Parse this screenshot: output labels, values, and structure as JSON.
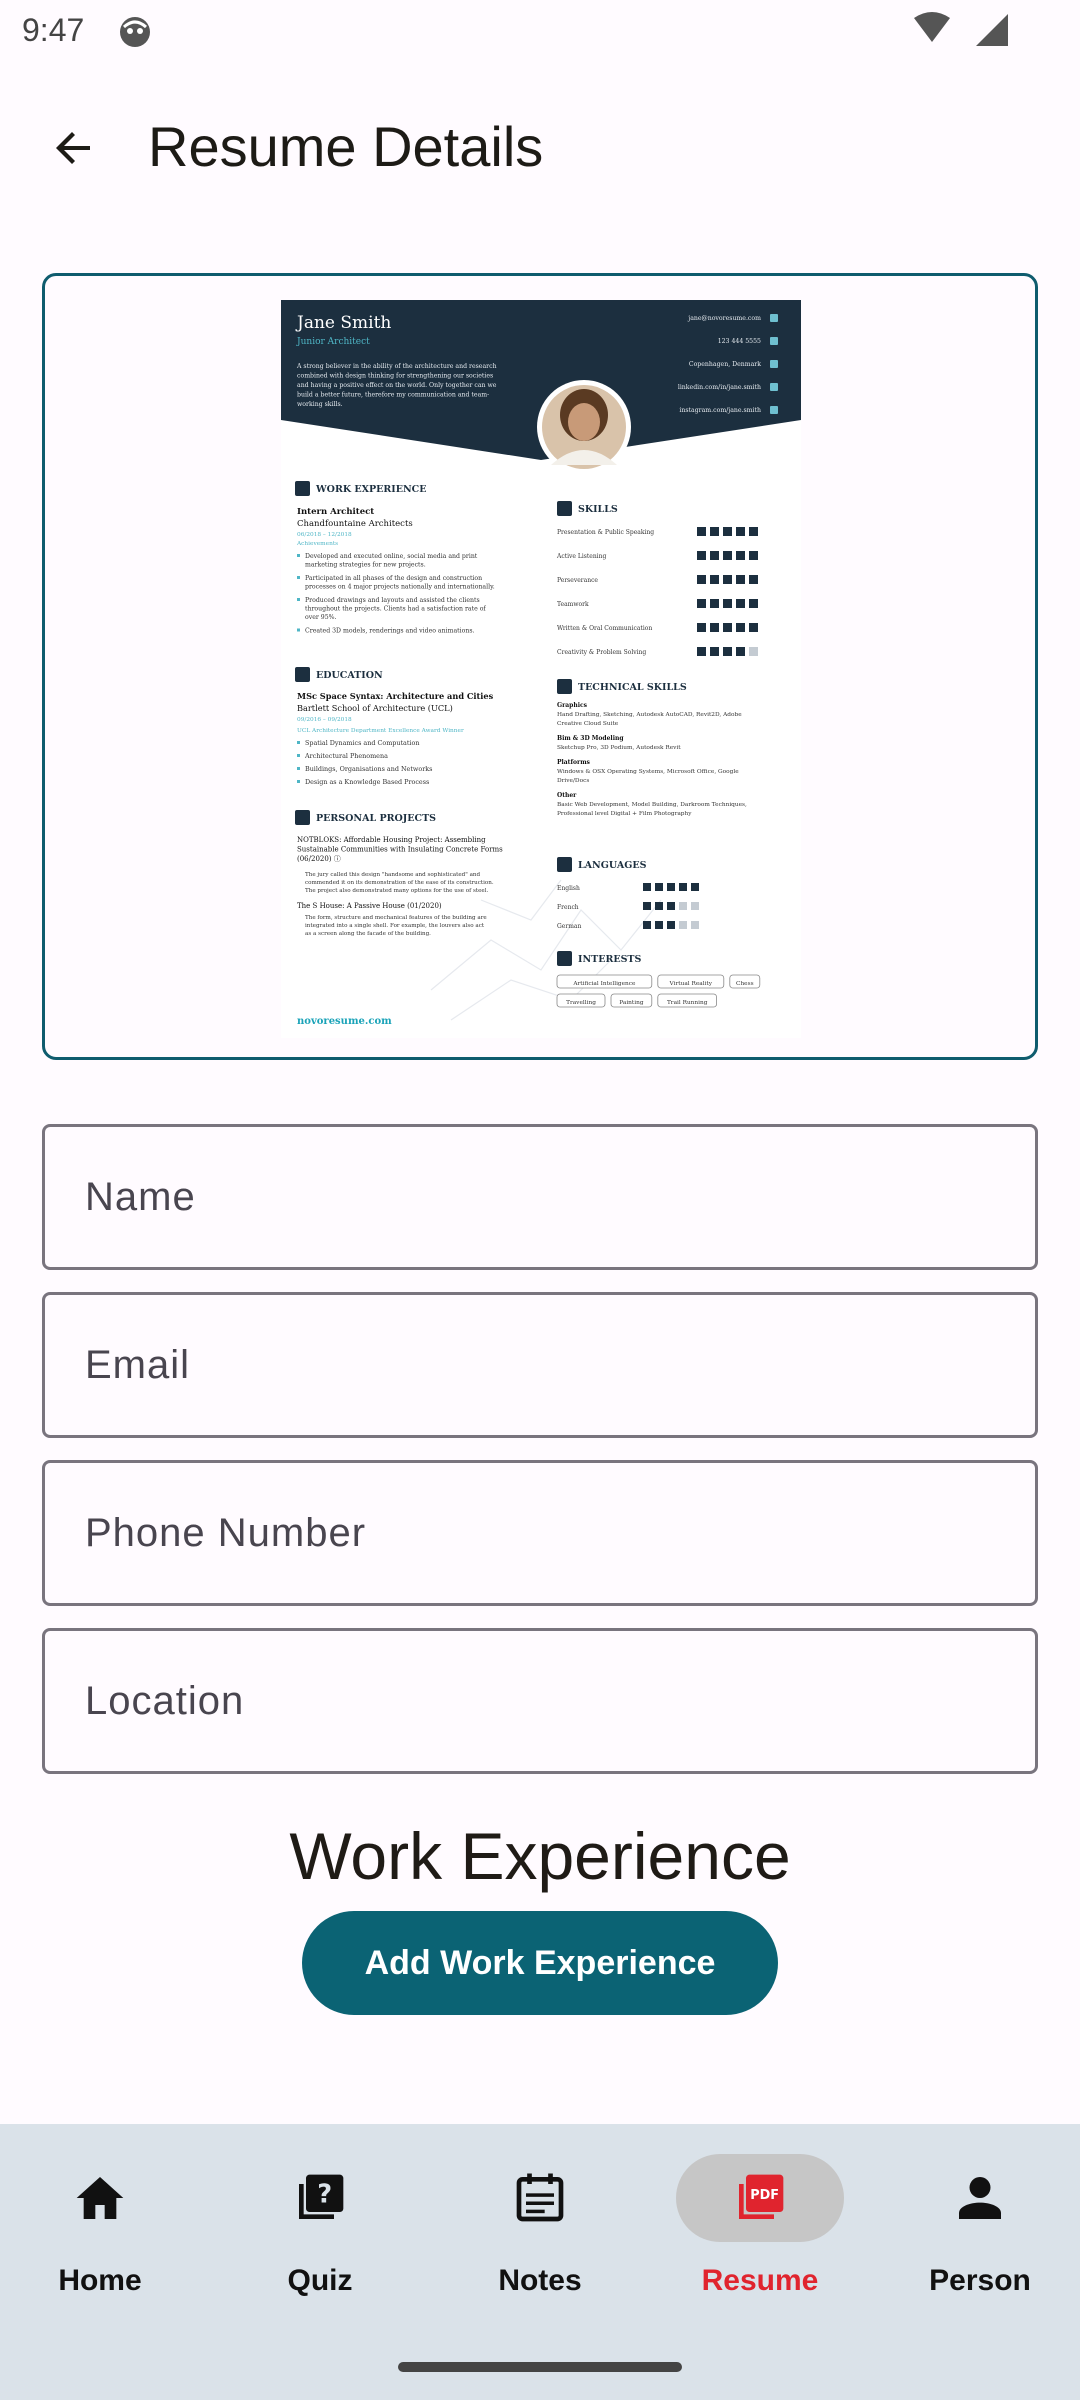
{
  "status_bar": {
    "time": "9:47"
  },
  "header": {
    "title": "Resume Details"
  },
  "resume_preview": {
    "name": "Jane Smith",
    "role": "Junior Architect",
    "summary_lines": [
      "A strong believer in the ability of the architecture and research",
      "combined with design thinking for strengthening our societies",
      "and having a positive effect on the world. Only together can we",
      "build a better future, therefore my communication and team-",
      "working skills."
    ],
    "contacts": [
      "jane@novoresume.com",
      "123 444 5555",
      "Copenhagen, Denmark",
      "linkedin.com/in/jane.smith",
      "instagram.com/jane.smith"
    ],
    "work_heading": "WORK EXPERIENCE",
    "work_title": "Intern Architect",
    "work_company": "Chandfountaine Architects",
    "work_dates": "06/2018 – 12/2018",
    "work_sub": "Achievements",
    "work_bullets": [
      "Developed and executed online, social media and print marketing strategies for new projects.",
      "Participated in all phases of the design and construction processes on 4 major projects nationally and internationally.",
      "Produced drawings and layouts and assisted the clients throughout the projects. Clients had a satisfaction rate of over 95%.",
      "Created 3D models, renderings and video animations."
    ],
    "education_heading": "EDUCATION",
    "edu_degree": "MSc Space Syntax: Architecture and Cities",
    "edu_school": "Bartlett School of Architecture (UCL)",
    "edu_dates": "09/2016 – 09/2018",
    "edu_note": "UCL Architecture Department Excellence Award Winner",
    "edu_bullets": [
      "Spatial Dynamics and Computation",
      "Architectural Phenomena",
      "Buildings, Organisations and Networks",
      "Design as a Knowledge Based Process"
    ],
    "projects_heading": "PERSONAL PROJECTS",
    "project1": [
      "NOTBLOKS: Affordable Housing Project: Assembling",
      "Sustainable Communities with Insulating Concrete Forms",
      "(06/2020) ⓘ"
    ],
    "project1_desc": [
      "The jury called this design \"handsome and sophisticated\" and commended it on its demonstration of the ease of its construction. The project also demonstrated many options for the use of steel."
    ],
    "project2": "The S House: A Passive House (01/2020)",
    "project2_desc": [
      "The form, structure and mechanical features of the building are integrated into a single shell. For example, the louvers also act as a screen along the facade of the building."
    ],
    "brand": "novoresume.com",
    "skills_heading": "SKILLS",
    "skills": [
      {
        "name": "Presentation & Public Speaking",
        "level": 5
      },
      {
        "name": "Active Listening",
        "level": 5
      },
      {
        "name": "Perseverance",
        "level": 5
      },
      {
        "name": "Teamwork",
        "level": 5
      },
      {
        "name": "Written & Oral Communication",
        "level": 5
      },
      {
        "name": "Creativity & Problem Solving",
        "level": 4
      }
    ],
    "tech_heading": "TECHNICAL SKILLS",
    "tech_groups": [
      {
        "title": "Graphics",
        "lines": [
          "Hand Drafting, Sketching, Autodesk AutoCAD, Revit2D, Adobe",
          "Creative Cloud Suite"
        ]
      },
      {
        "title": "Bim & 3D Modeling",
        "lines": [
          "Sketchup Pro, 3D Podium, Autodesk Revit"
        ]
      },
      {
        "title": "Platforms",
        "lines": [
          "Windows & OSX Operating Systems, Microsoft Office, Google",
          "Drive/Docs"
        ]
      },
      {
        "title": "Other",
        "lines": [
          "Basic Web Development, Model Building, Darkroom Techniques,",
          "Professional level Digital + Film Photography"
        ]
      }
    ],
    "languages_heading": "LANGUAGES",
    "languages": [
      {
        "name": "English",
        "level": 5
      },
      {
        "name": "French",
        "level": 3
      },
      {
        "name": "German",
        "level": 3
      }
    ],
    "interests_heading": "INTERESTS",
    "interests": [
      "Artificial Intelligence",
      "Virtual Reality",
      "Chess",
      "Travelling",
      "Painting",
      "Trail Running"
    ]
  },
  "form": {
    "name_placeholder": "Name",
    "email_placeholder": "Email",
    "phone_placeholder": "Phone Number",
    "location_placeholder": "Location"
  },
  "work_experience": {
    "heading": "Work Experience",
    "add_label": "Add Work Experience"
  },
  "bottom_nav": {
    "items": [
      {
        "label": "Home",
        "icon": "home-icon"
      },
      {
        "label": "Quiz",
        "icon": "quiz-icon"
      },
      {
        "label": "Notes",
        "icon": "notes-icon"
      },
      {
        "label": "Resume",
        "icon": "pdf-icon"
      },
      {
        "label": "Person",
        "icon": "person-icon"
      }
    ],
    "active": "Resume"
  },
  "colors": {
    "accent": "#0b6374",
    "card_border": "#0f5c6e",
    "nav_bg": "#dae2e9",
    "active_label": "#e0242e",
    "resume_header": "#1c2f3f"
  }
}
